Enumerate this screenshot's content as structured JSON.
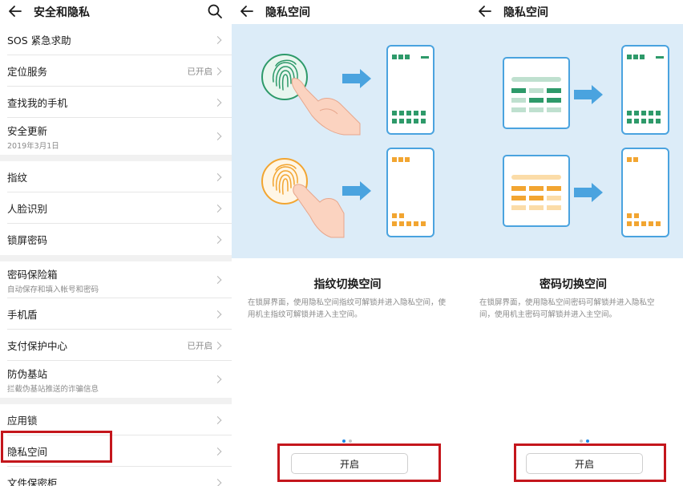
{
  "left_panel": {
    "title": "安全和隐私",
    "groups": [
      [
        {
          "label": "SOS 紧急求助"
        },
        {
          "label": "定位服务",
          "value": "已开启"
        },
        {
          "label": "查找我的手机"
        },
        {
          "label": "安全更新",
          "sub": "2019年3月1日"
        }
      ],
      [
        {
          "label": "指纹"
        },
        {
          "label": "人脸识别"
        },
        {
          "label": "锁屏密码"
        }
      ],
      [
        {
          "label": "密码保险箱",
          "sub": "自动保存和填入帐号和密码"
        },
        {
          "label": "手机盾"
        },
        {
          "label": "支付保护中心",
          "value": "已开启"
        },
        {
          "label": "防伪基站",
          "sub": "拦截伪基站推送的诈骗信息"
        }
      ],
      [
        {
          "label": "应用锁"
        },
        {
          "label": "隐私空间"
        },
        {
          "label": "文件保密柜"
        }
      ]
    ]
  },
  "middle_panel": {
    "title": "隐私空间",
    "caption_title": "指纹切换空间",
    "caption_desc": "在锁屏界面，使用隐私空间指纹可解锁并进入隐私空间，使用机主指纹可解锁并进入主空间。",
    "button": "开启",
    "active_dot": 1
  },
  "right_panel": {
    "title": "隐私空间",
    "caption_title": "密码切换空间",
    "caption_desc": "在锁屏界面，使用隐私空间密码可解锁并进入隐私空间，使用机主密码可解锁并进入主空间。",
    "button": "开启",
    "active_dot": 2
  },
  "colors": {
    "accent_blue": "#4aa3df",
    "highlight_red": "#c4161c",
    "illustration_bg": "#dcecf8",
    "private_green": "#2e9a6a",
    "owner_orange": "#f2a531"
  },
  "icons": [
    "back-arrow-icon",
    "search-icon",
    "chevron-right-icon",
    "fingerprint-icon",
    "hand-icon",
    "arrow-right-icon",
    "phone-icon",
    "password-keypad-icon"
  ]
}
